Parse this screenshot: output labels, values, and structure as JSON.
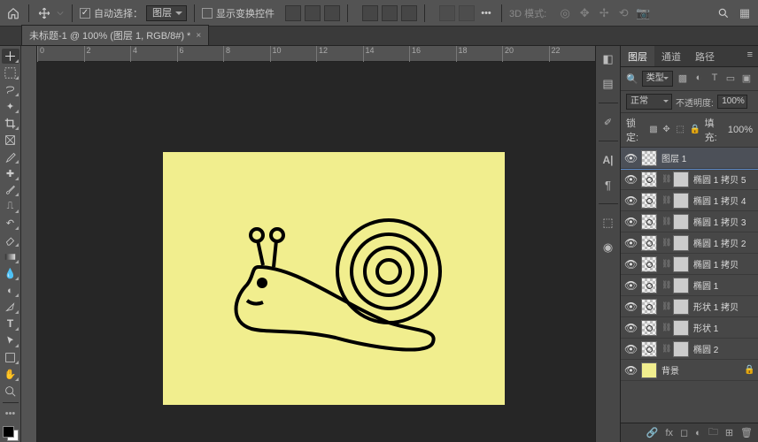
{
  "menubar": {
    "auto_select_label": "自动选择：",
    "auto_select_value": "图层",
    "show_transform_label": "显示变换控件",
    "mode3d_label": "3D 模式:"
  },
  "file_tab": {
    "title": "未标题-1 @ 100% (图层 1, RGB/8#) *"
  },
  "ruler_ticks": [
    "0",
    "2",
    "4",
    "6",
    "8",
    "10",
    "12",
    "14",
    "16",
    "18",
    "20",
    "22"
  ],
  "panel": {
    "tabs": [
      "图层",
      "通道",
      "路径"
    ],
    "filter_label": "类型",
    "blend_mode": "正常",
    "opacity_label": "不透明度:",
    "opacity_value": "100%",
    "lock_label": "锁定:",
    "fill_label": "填充:",
    "fill_value": "100%"
  },
  "layers": [
    {
      "name": "图层 1",
      "active": true,
      "kind": "checker"
    },
    {
      "name": "椭圆 1 拷贝 5",
      "kind": "shape"
    },
    {
      "name": "椭圆 1 拷贝 4",
      "kind": "shape"
    },
    {
      "name": "椭圆 1 拷贝 3",
      "kind": "shape"
    },
    {
      "name": "椭圆 1 拷贝 2",
      "kind": "shape"
    },
    {
      "name": "椭圆 1 拷贝",
      "kind": "shape"
    },
    {
      "name": "椭圆 1",
      "kind": "shape"
    },
    {
      "name": "形状 1 拷贝",
      "kind": "shape"
    },
    {
      "name": "形状 1",
      "kind": "shape"
    },
    {
      "name": "椭圆 2",
      "kind": "shape"
    },
    {
      "name": "背景",
      "kind": "bg",
      "locked": true
    }
  ]
}
